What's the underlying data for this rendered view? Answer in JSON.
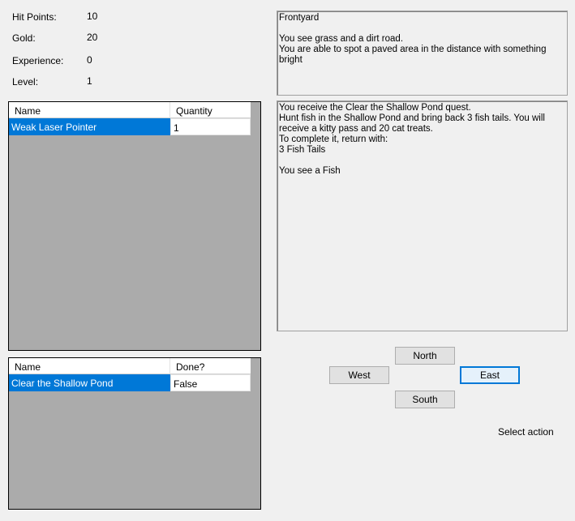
{
  "stats": [
    {
      "label": "Hit Points:",
      "value": "10"
    },
    {
      "label": "Gold:",
      "value": "20"
    },
    {
      "label": "Experience:",
      "value": "0"
    },
    {
      "label": "Level:",
      "value": "1"
    }
  ],
  "inventory": {
    "headers": [
      "Name",
      "Quantity"
    ],
    "rows": [
      {
        "name": "Weak Laser Pointer",
        "quantity": "1"
      }
    ]
  },
  "quests": {
    "headers": [
      "Name",
      "Done?"
    ],
    "rows": [
      {
        "name": "Clear the Shallow Pond",
        "done": "False"
      }
    ]
  },
  "location": {
    "lines": [
      "Frontyard",
      "",
      "You see grass and a dirt road.",
      "You are able to spot a paved area in the distance with something bright"
    ]
  },
  "messages": {
    "lines": [
      "You receive the Clear the Shallow Pond quest.",
      "Hunt fish in the Shallow Pond and bring back 3 fish tails. You will receive a kitty pass and 20 cat treats.",
      "To complete it, return with:",
      "3 Fish Tails",
      "",
      "You see a Fish"
    ]
  },
  "buttons": {
    "north": "North",
    "west": "West",
    "east": "East",
    "south": "South"
  },
  "status": {
    "action": "Select action"
  },
  "colors": {
    "selection": "#0078d7",
    "grid_background": "#ababab",
    "window_background": "#f0f0f0"
  }
}
